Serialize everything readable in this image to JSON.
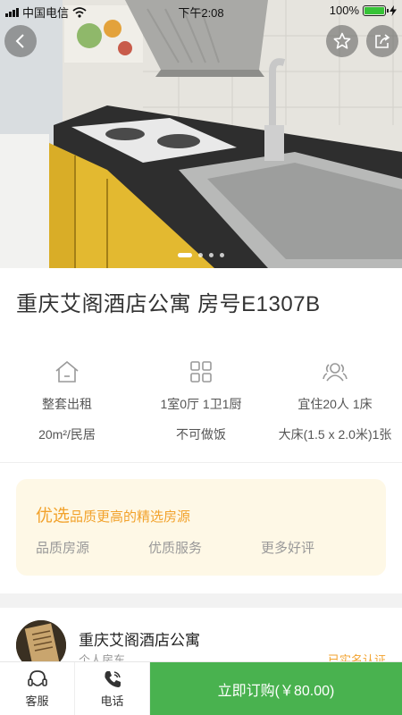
{
  "status_bar": {
    "carrier": "中国电信",
    "time": "下午2:08",
    "battery": "100%"
  },
  "gallery": {
    "active_index": 0,
    "slide_count": 4
  },
  "listing": {
    "title": "重庆艾阁酒店公寓 房号E1307B"
  },
  "features": [
    {
      "icon": "house-icon",
      "line1": "整套出租",
      "line2": "20m²/民居"
    },
    {
      "icon": "grid-icon",
      "line1": "1室0厅 1卫1厨",
      "line2": "不可做饭"
    },
    {
      "icon": "people-icon",
      "line1": "宜住20人 1床",
      "line2": "大床(1.5 x 2.0米)1张"
    }
  ],
  "promo": {
    "highlight": "优选",
    "tagline": "品质更高的精选房源",
    "tags": [
      "品质房源",
      "优质服务",
      "更多好评"
    ]
  },
  "host": {
    "name": "重庆艾阁酒店公寓",
    "role": "个人房东",
    "verified": "已实名认证"
  },
  "bottom_bar": {
    "service_label": "客服",
    "phone_label": "电话",
    "book_label": "立即订购(￥80.00)"
  },
  "colors": {
    "accent_green": "#49b24f",
    "promo_orange": "#f2a22c",
    "promo_bg": "#fef8e6"
  }
}
